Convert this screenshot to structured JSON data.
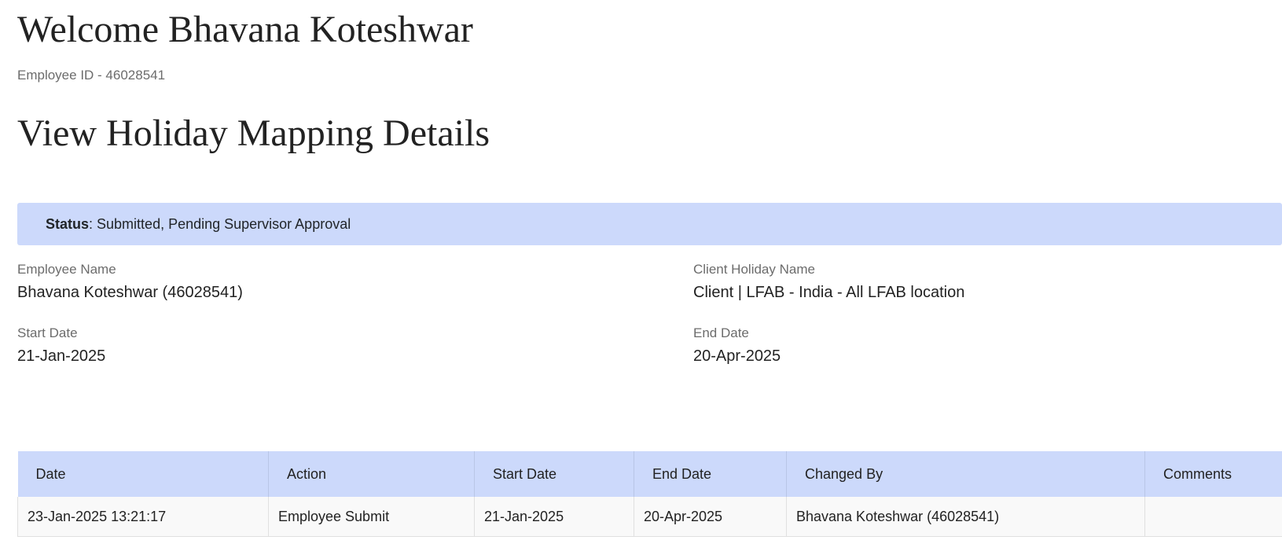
{
  "header": {
    "welcome": "Welcome Bhavana Koteshwar",
    "employee_id": "Employee ID - 46028541"
  },
  "page": {
    "title": "View Holiday Mapping Details"
  },
  "status": {
    "label": "Status",
    "separator": ": ",
    "value": "Submitted, Pending Supervisor Approval"
  },
  "details": {
    "employee_name": {
      "label": "Employee Name",
      "value": "Bhavana Koteshwar (46028541)"
    },
    "client_holiday_name": {
      "label": "Client Holiday Name",
      "value": "Client | LFAB - India - All LFAB location"
    },
    "start_date": {
      "label": "Start Date",
      "value": "21-Jan-2025"
    },
    "end_date": {
      "label": "End Date",
      "value": "20-Apr-2025"
    }
  },
  "history": {
    "columns": [
      "Date",
      "Action",
      "Start Date",
      "End Date",
      "Changed By",
      "Comments"
    ],
    "rows": [
      [
        "23-Jan-2025 13:21:17",
        "Employee Submit",
        "21-Jan-2025",
        "20-Apr-2025",
        "Bhavana Koteshwar (46028541)",
        ""
      ]
    ]
  },
  "colors": {
    "accent_bg": "#ccd9fb",
    "row_bg": "#f9f9f9"
  }
}
